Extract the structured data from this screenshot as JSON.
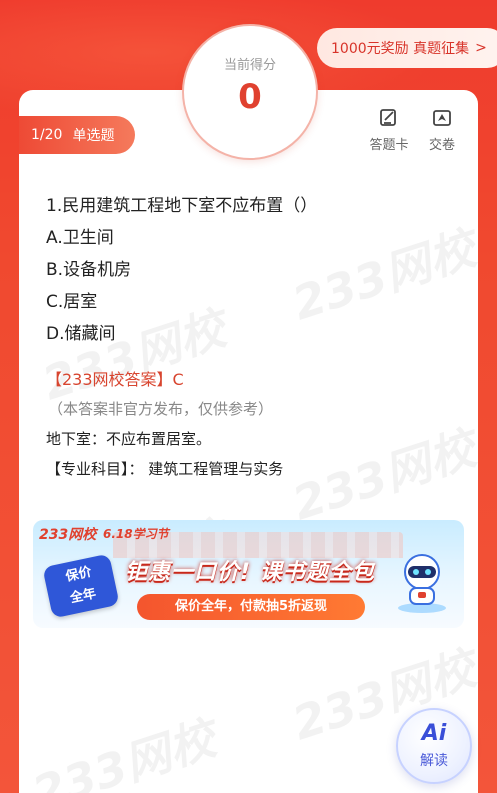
{
  "header": {
    "award_label": "1000元奖励 真题征集",
    "award_arrow": ">"
  },
  "score": {
    "label": "当前得分",
    "value": "0"
  },
  "question_meta": {
    "progress": "1/20",
    "type": "单选题"
  },
  "tools": {
    "answer_sheet_label": "答题卡",
    "submit_label": "交卷",
    "answer_sheet_icon": "edit-sheet-icon",
    "submit_icon": "send-icon"
  },
  "question": {
    "title": "1.民用建筑工程地下室不应布置（）",
    "options": [
      "A.卫生间",
      "B.设备机房",
      "C.居室",
      "D.储藏间"
    ]
  },
  "answer": {
    "label": "【233网校答案】C",
    "note": "（本答案非官方发布，仅供参考）",
    "explanation": "地下室：不应布置居室。",
    "subject": "【专业科目】：  建筑工程管理与实务"
  },
  "banner": {
    "brand": "233网校",
    "festival": "6.18学习节",
    "badge_line1": "保价",
    "badge_line2": "全年",
    "headline": "钜惠一口价! 课书题全包",
    "subline": "保价全年，付款抽5折返现"
  },
  "watermark_text": "233网校",
  "ai_button": {
    "logo": "Ai",
    "label": "解读"
  },
  "colors": {
    "brand_red": "#e0412f",
    "ai_blue": "#3a4fd8"
  }
}
